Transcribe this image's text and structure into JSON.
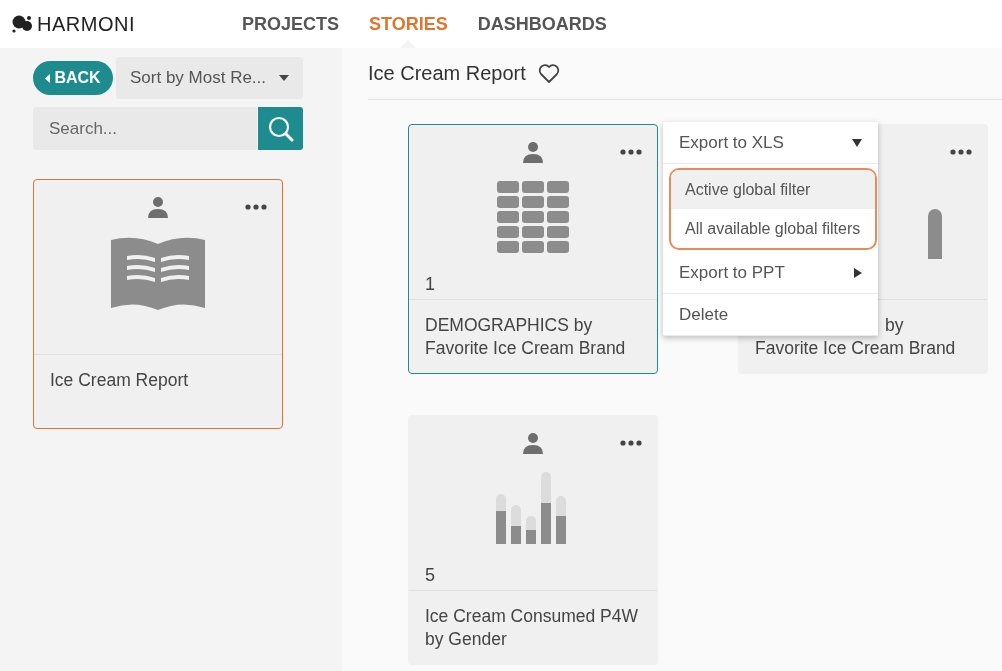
{
  "logo": {
    "text": "HARMONI"
  },
  "nav": [
    {
      "label": "PROJECTS",
      "selected": false
    },
    {
      "label": "STORIES",
      "selected": true
    },
    {
      "label": "DASHBOARDS",
      "selected": false
    }
  ],
  "sidebar": {
    "back_button": "BACK",
    "sort": {
      "value": "Sort by Most Re..."
    },
    "search": {
      "placeholder": "Search..."
    },
    "stories": [
      {
        "title": "Ice Cream Report",
        "selected": true,
        "kind": "book"
      }
    ]
  },
  "main": {
    "title": "Ice Cream Report",
    "cards": [
      {
        "kind": "table",
        "number": "1",
        "title": "DEMOGRAPHICS by Favorite Ice Cream Brand",
        "selected": true
      },
      {
        "kind": "bars-partial",
        "title": "by",
        "title_line_2": "Favorite Ice Cream Brand",
        "selected": false
      },
      {
        "kind": "bars",
        "number": "5",
        "title": "Ice Cream Consumed P4W by Gender",
        "selected": false
      }
    ],
    "context_menu": {
      "items": [
        {
          "label": "Export to XLS",
          "kind": "expanded"
        },
        {
          "kind": "submenu",
          "highlighted": true,
          "items": [
            {
              "label": "Active global filter",
              "selected": true
            },
            {
              "label": "All available global filters",
              "selected": false
            }
          ]
        },
        {
          "label": "Export to PPT",
          "kind": "arrow"
        },
        {
          "label": "Delete",
          "kind": "plain"
        }
      ]
    }
  }
}
